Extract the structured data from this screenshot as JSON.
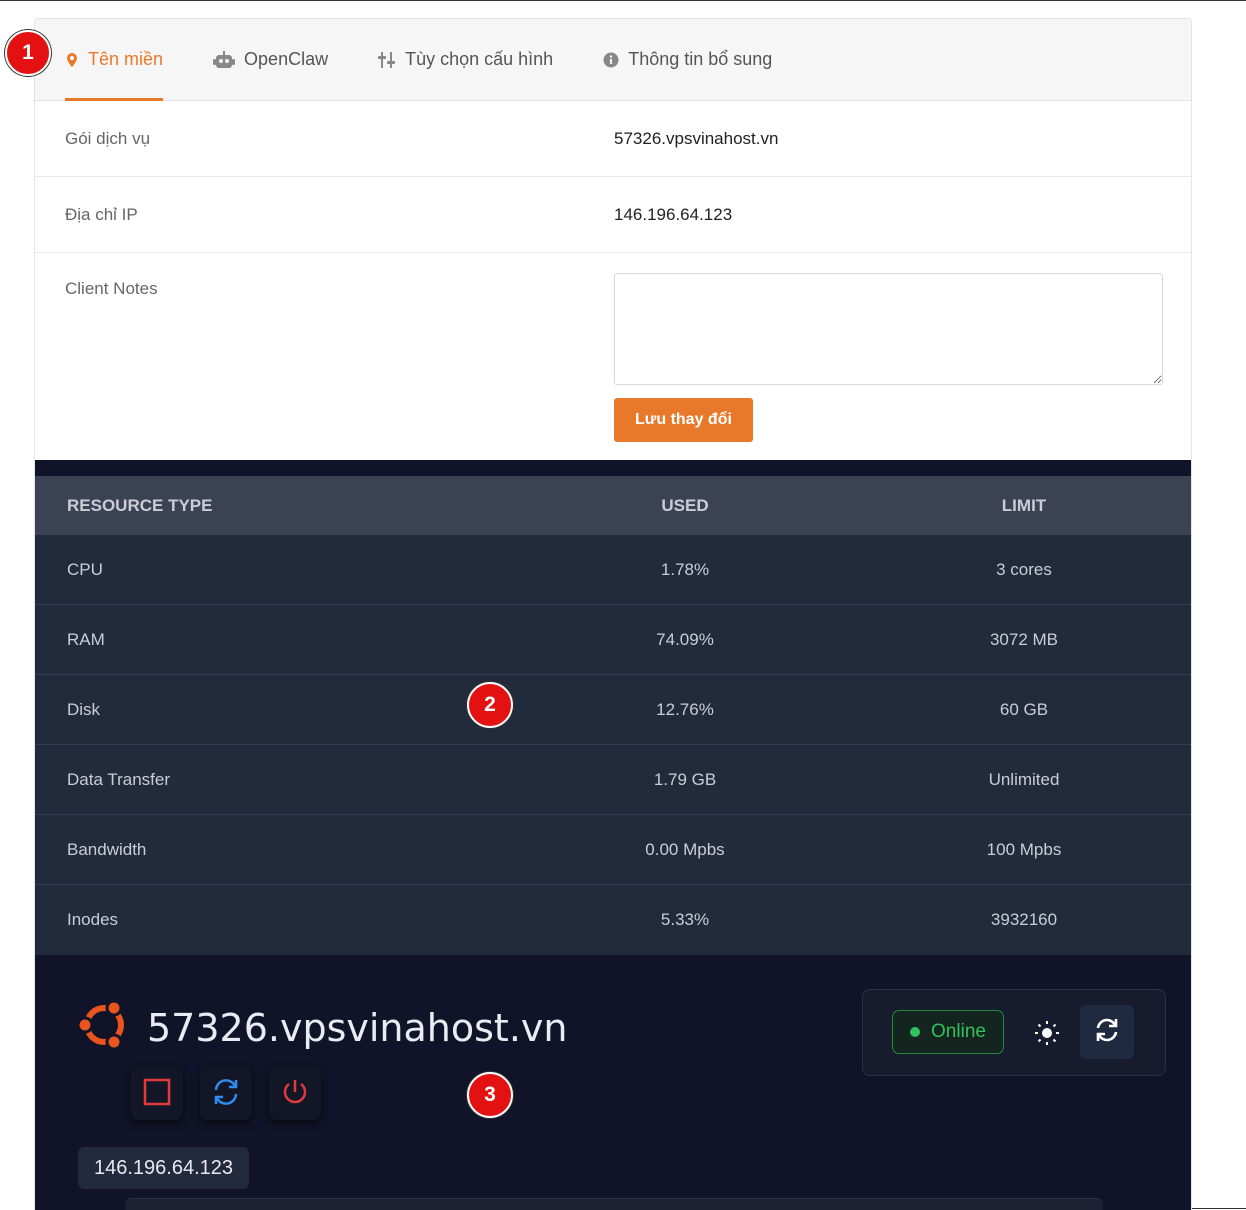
{
  "tabs": [
    {
      "label": "Tên miền",
      "icon": "map-pin-icon",
      "active": true
    },
    {
      "label": "OpenClaw",
      "icon": "robot-icon",
      "active": false
    },
    {
      "label": "Tùy chọn cấu hình",
      "icon": "sliders-icon",
      "active": false
    },
    {
      "label": "Thông tin bổ sung",
      "icon": "info-icon",
      "active": false
    }
  ],
  "info": {
    "service_label": "Gói dịch vụ",
    "service_value": "57326.vpsvinahost.vn",
    "ip_label": "Địa chỉ IP",
    "ip_value": "146.196.64.123",
    "notes_label": "Client Notes",
    "notes_value": "",
    "save_label": "Lưu thay đổi"
  },
  "resources": {
    "headers": [
      "RESOURCE TYPE",
      "USED",
      "LIMIT"
    ],
    "rows": [
      {
        "type": "CPU",
        "used": "1.78%",
        "limit": "3 cores"
      },
      {
        "type": "RAM",
        "used": "74.09%",
        "limit": "3072 MB"
      },
      {
        "type": "Disk",
        "used": "12.76%",
        "limit": "60 GB"
      },
      {
        "type": "Data Transfer",
        "used": "1.79 GB",
        "limit": "Unlimited"
      },
      {
        "type": "Bandwidth",
        "used": "0.00 Mpbs",
        "limit": "100 Mpbs"
      },
      {
        "type": "Inodes",
        "used": "5.33%",
        "limit": "3932160"
      }
    ]
  },
  "vps": {
    "hostname": "57326.vpsvinahost.vn",
    "ip": "146.196.64.123",
    "status": "Online",
    "os_icon": "ubuntu-logo-icon"
  },
  "markers": [
    "1",
    "2",
    "3"
  ],
  "colors": {
    "accent": "#e8792a",
    "online": "#32c15a",
    "stop": "#e03a3a",
    "restart": "#2f8cf0",
    "dark_bg": "#111428"
  }
}
